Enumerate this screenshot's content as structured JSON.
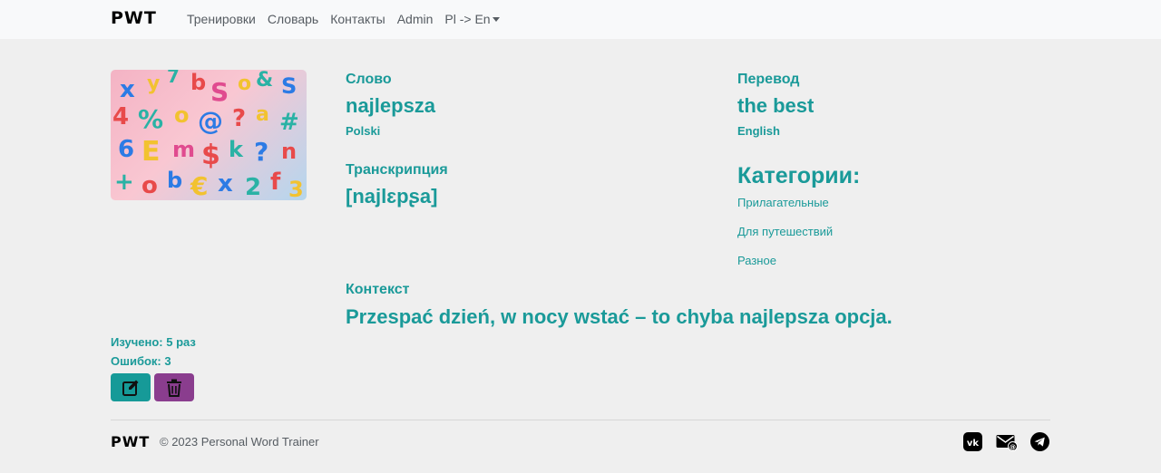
{
  "navbar": {
    "brand": "PWT",
    "links": [
      "Тренировки",
      "Словарь",
      "Контакты",
      "Admin"
    ],
    "language_dropdown": "Pl -> En"
  },
  "word": {
    "word_label": "Слово",
    "word": "najlepsza",
    "word_language": "Polski",
    "transcription_label": "Транскрипция",
    "transcription": "[najlɛpʂa]",
    "translation_label": "Перевод",
    "translation": "the best",
    "translation_language": "English",
    "categories_label": "Категории:",
    "categories": [
      "Прилагательные",
      "Для путешествий",
      "Разное"
    ],
    "context_label": "Контекст",
    "context": "Przespać dzień, w nocy wstać – to chyba najlepsza opcja."
  },
  "stats": {
    "learned": "Изучено: 5 раз",
    "errors": "Ошибок: 3"
  },
  "actions": {
    "edit_icon": "edit-icon",
    "delete_icon": "trash-icon"
  },
  "footer": {
    "brand": "PWT",
    "copyright": "© 2023 Personal Word Trainer",
    "social": [
      "vk-icon",
      "mail-icon",
      "telegram-icon"
    ]
  },
  "colors": {
    "accent": "#1a9a99",
    "edit_button": "#169a98",
    "delete_button": "#8a3d8e",
    "navbar_bg": "#f8f9fa",
    "page_bg": "#efefef"
  }
}
